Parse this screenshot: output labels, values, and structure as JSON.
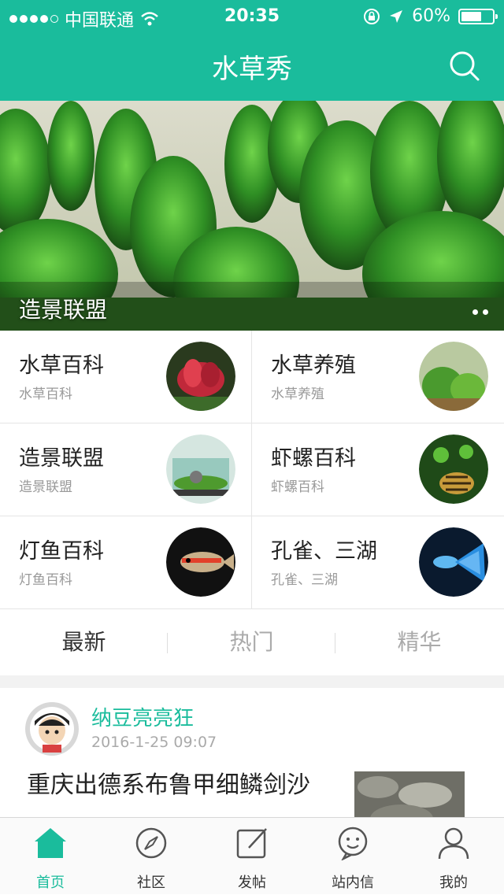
{
  "status_bar": {
    "carrier": "中国联通",
    "time": "20:35",
    "battery": "60%"
  },
  "nav": {
    "title": "水草秀",
    "search_icon": "search-icon"
  },
  "banner": {
    "caption": "造景联盟",
    "page_count": 2
  },
  "categories": [
    {
      "title": "水草百科",
      "subtitle": "水草百科"
    },
    {
      "title": "水草养殖",
      "subtitle": "水草养殖"
    },
    {
      "title": "造景联盟",
      "subtitle": "造景联盟"
    },
    {
      "title": "虾螺百科",
      "subtitle": "虾螺百科"
    },
    {
      "title": "灯鱼百科",
      "subtitle": "灯鱼百科"
    },
    {
      "title": "孔雀、三湖",
      "subtitle": "孔雀、三湖"
    }
  ],
  "tabs": [
    {
      "label": "最新",
      "active": true
    },
    {
      "label": "热门",
      "active": false
    },
    {
      "label": "精华",
      "active": false
    }
  ],
  "post": {
    "author": "纳豆亮亮狂",
    "time": "2016-1-25 09:07",
    "title": "重庆出德系布鲁甲细鳞剑沙"
  },
  "tabbar": [
    {
      "label": "首页",
      "icon": "home-icon",
      "active": true
    },
    {
      "label": "社区",
      "icon": "compass-icon",
      "active": false
    },
    {
      "label": "发帖",
      "icon": "compose-icon",
      "active": false
    },
    {
      "label": "站内信",
      "icon": "message-icon",
      "active": false
    },
    {
      "label": "我的",
      "icon": "user-icon",
      "active": false
    }
  ],
  "colors": {
    "accent": "#1abc9c",
    "muted": "#aaaaaa"
  }
}
